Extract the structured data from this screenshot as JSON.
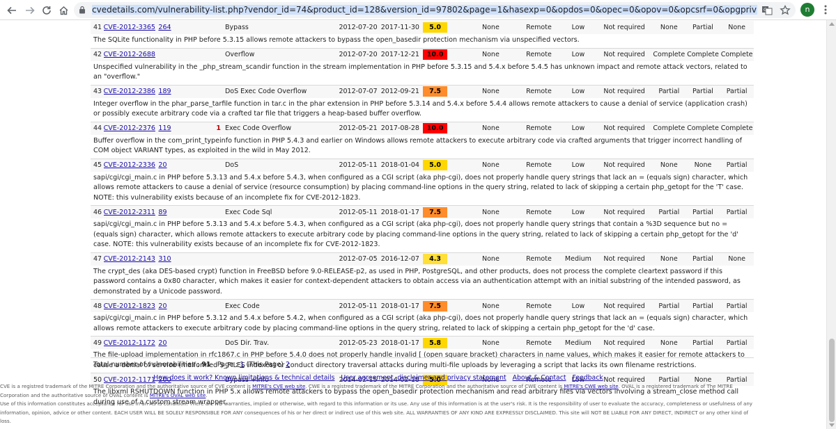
{
  "browser": {
    "url": "cvedetails.com/vulnerability-list.php?vendor_id=74&product_id=128&version_id=97802&page=1&hasexp=0&opdos=0&opec=0&opov=0&opcsrf=0&opgpriv=0&opsqli=0&opxss=0&opdirt=0&o",
    "profile_initial": "n"
  },
  "rows": [
    {
      "num": "41",
      "cve": "CVE-2012-3365",
      "cwe": "264",
      "exploits": "",
      "type": "Bypass",
      "published": "2012-07-20",
      "updated": "2017-11-30",
      "score": "5.0",
      "score_color": "#ffd700",
      "gained": "None",
      "access": "Remote",
      "complexity": "Low",
      "auth": "Not required",
      "conf": "None",
      "integ": "Partial",
      "avail": "None",
      "summary": "The SQLite functionality in PHP before 5.3.15 allows remote attackers to bypass the open_basedir protection mechanism via unspecified vectors."
    },
    {
      "num": "42",
      "cve": "CVE-2012-2688",
      "cwe": "",
      "exploits": "",
      "type": "Overflow",
      "published": "2012-07-20",
      "updated": "2017-12-21",
      "score": "10.0",
      "score_color": "#ff0000",
      "gained": "None",
      "access": "Remote",
      "complexity": "Low",
      "auth": "Not required",
      "conf": "Complete",
      "integ": "Complete",
      "avail": "Complete",
      "summary": "Unspecified vulnerability in the _php_stream_scandir function in the stream implementation in PHP before 5.3.15 and 5.4.x before 5.4.5 has unknown impact and remote attack vectors, related to an \"overflow.\""
    },
    {
      "num": "43",
      "cve": "CVE-2012-2386",
      "cwe": "189",
      "exploits": "",
      "type": "DoS Exec Code Overflow",
      "published": "2012-07-07",
      "updated": "2012-09-21",
      "score": "7.5",
      "score_color": "#ff8c2a",
      "gained": "None",
      "access": "Remote",
      "complexity": "Low",
      "auth": "Not required",
      "conf": "Partial",
      "integ": "Partial",
      "avail": "Partial",
      "summary": "Integer overflow in the phar_parse_tarfile function in tar.c in the phar extension in PHP before 5.3.14 and 5.4.x before 5.4.4 allows remote attackers to cause a denial of service (application crash) or possibly execute arbitrary code via a crafted tar file that triggers a heap-based buffer overflow."
    },
    {
      "num": "44",
      "cve": "CVE-2012-2376",
      "cwe": "119",
      "exploits": "1",
      "type": "Exec Code Overflow",
      "published": "2012-05-21",
      "updated": "2017-08-28",
      "score": "10.0",
      "score_color": "#ff0000",
      "gained": "None",
      "access": "Remote",
      "complexity": "Low",
      "auth": "Not required",
      "conf": "Complete",
      "integ": "Complete",
      "avail": "Complete",
      "summary": "Buffer overflow in the com_print_typeinfo function in PHP 5.4.3 and earlier on Windows allows remote attackers to execute arbitrary code via crafted arguments that trigger incorrect handling of COM object VARIANT types, as exploited in the wild in May 2012."
    },
    {
      "num": "45",
      "cve": "CVE-2012-2336",
      "cwe": "20",
      "exploits": "",
      "type": "DoS",
      "published": "2012-05-11",
      "updated": "2018-01-04",
      "score": "5.0",
      "score_color": "#ffd700",
      "gained": "None",
      "access": "Remote",
      "complexity": "Low",
      "auth": "Not required",
      "conf": "None",
      "integ": "None",
      "avail": "Partial",
      "summary": "sapi/cgi/cgi_main.c in PHP before 5.3.13 and 5.4.x before 5.4.3, when configured as a CGI script (aka php-cgi), does not properly handle query strings that lack an = (equals sign) character, which allows remote attackers to cause a denial of service (resource consumption) by placing command-line options in the query string, related to lack of skipping a certain php_getopt for the 'T' case. NOTE: this vulnerability exists because of an incomplete fix for CVE-2012-1823."
    },
    {
      "num": "46",
      "cve": "CVE-2012-2311",
      "cwe": "89",
      "exploits": "",
      "type": "Exec Code Sql",
      "published": "2012-05-11",
      "updated": "2018-01-17",
      "score": "7.5",
      "score_color": "#ff8c2a",
      "gained": "None",
      "access": "Remote",
      "complexity": "Low",
      "auth": "Not required",
      "conf": "Partial",
      "integ": "Partial",
      "avail": "Partial",
      "summary": "sapi/cgi/cgi_main.c in PHP before 5.3.13 and 5.4.x before 5.4.3, when configured as a CGI script (aka php-cgi), does not properly handle query strings that contain a %3D sequence but no = (equals sign) character, which allows remote attackers to execute arbitrary code by placing command-line options in the query string, related to lack of skipping a certain php_getopt for the 'd' case. NOTE: this vulnerability exists because of an incomplete fix for CVE-2012-1823."
    },
    {
      "num": "47",
      "cve": "CVE-2012-2143",
      "cwe": "310",
      "exploits": "",
      "type": "",
      "published": "2012-07-05",
      "updated": "2016-12-07",
      "score": "4.3",
      "score_color": "#ffdf38",
      "gained": "None",
      "access": "Remote",
      "complexity": "Medium",
      "auth": "Not required",
      "conf": "None",
      "integ": "Partial",
      "avail": "None",
      "summary": "The crypt_des (aka DES-based crypt) function in FreeBSD before 9.0-RELEASE-p2, as used in PHP, PostgreSQL, and other products, does not process the complete cleartext password if this password contains a 0x80 character, which makes it easier for context-dependent attackers to obtain access via an authentication attempt with an initial substring of the intended password, as demonstrated by a Unicode password."
    },
    {
      "num": "48",
      "cve": "CVE-2012-1823",
      "cwe": "20",
      "exploits": "",
      "type": "Exec Code",
      "published": "2012-05-11",
      "updated": "2018-01-17",
      "score": "7.5",
      "score_color": "#ff8c2a",
      "gained": "None",
      "access": "Remote",
      "complexity": "Low",
      "auth": "Not required",
      "conf": "Partial",
      "integ": "Partial",
      "avail": "Partial",
      "summary": "sapi/cgi/cgi_main.c in PHP before 5.3.12 and 5.4.x before 5.4.2, when configured as a CGI script (aka php-cgi), does not properly handle query strings that lack an = (equals sign) character, which allows remote attackers to execute arbitrary code by placing command-line options in the query string, related to lack of skipping a certain php_getopt for the 'd' case."
    },
    {
      "num": "49",
      "cve": "CVE-2012-1172",
      "cwe": "20",
      "exploits": "",
      "type": "DoS Dir. Trav.",
      "published": "2012-05-23",
      "updated": "2018-01-17",
      "score": "5.8",
      "score_color": "#ffd700",
      "gained": "None",
      "access": "Remote",
      "complexity": "Medium",
      "auth": "Not required",
      "conf": "None",
      "integ": "Partial",
      "avail": "Partial",
      "summary": "The file-upload implementation in rfc1867.c in PHP before 5.4.0 does not properly handle invalid [ (open square bracket) characters in name values, which makes it easier for remote attackers to cause a denial of service (malformed $_FILES indexes) or conduct directory traversal attacks during multi-file uploads by leveraging a script that lacks its own filename restrictions."
    },
    {
      "num": "50",
      "cve": "CVE-2012-1171",
      "cwe": "200",
      "exploits": "",
      "type": "Bypass +Info",
      "published": "2014-02-15",
      "updated": "2014-02-18",
      "score": "5.0",
      "score_color": "#ffd700",
      "gained": "None",
      "access": "Remote",
      "complexity": "Low",
      "auth": "Not required",
      "conf": "Partial",
      "integ": "None",
      "avail": "Partial",
      "summary": "The libxml RSHUTDOWN function in PHP 5.x allows remote attackers to bypass the open_basedir protection mechanism and read arbitrary files via vectors involving a stream_close method call during use of a custom stream wrapper."
    }
  ],
  "totals": {
    "label": "Total number of vulnerabilities :",
    "count": "91",
    "page_label": "Page :",
    "page_current": "1",
    "page_current_note": "(This Page)",
    "page_next": "2"
  },
  "footer": {
    "links": [
      "How does it work? Known limitations & technical details",
      "User agreement, disclaimer and privacy statement",
      "About & Contact",
      "Feedback"
    ],
    "legal1_a": "CVE is a registred trademark of the MITRE Corporation and the authoritative source of CVE content is ",
    "legal1_link1": "MITRE's CVE web site",
    "legal1_b": ". CWE is a registred trademark of the MITRE Corporation and the authoritative source of CWE content is ",
    "legal1_link2": "MITRE's CWE web site",
    "legal1_c": ". OVAL is a registered trademark of The MITRE Corporation and the authoritative source of OVAL content is ",
    "legal1_link3": "MITRE's OVAL web site",
    "legal1_d": ".",
    "legal2": "Use of this information constitutes acceptance for use in an AS IS condition. There are NO warranties, implied or otherwise, with regard to this information or its use. Any use of this information is at the user's risk. It is the responsibility of user to evaluate the accuracy, completeness or usefulness of any information, opinion, advice or other content. EACH USER WILL BE SOLELY RESPONSIBLE FOR ANY consequences of his or her direct or indirect use of this web site. ALL WARRANTIES OF ANY KIND ARE EXPRESSLY DISCLAIMED. This site will NOT BE LIABLE FOR ANY DIRECT, INDIRECT or any other kind of loss."
  }
}
